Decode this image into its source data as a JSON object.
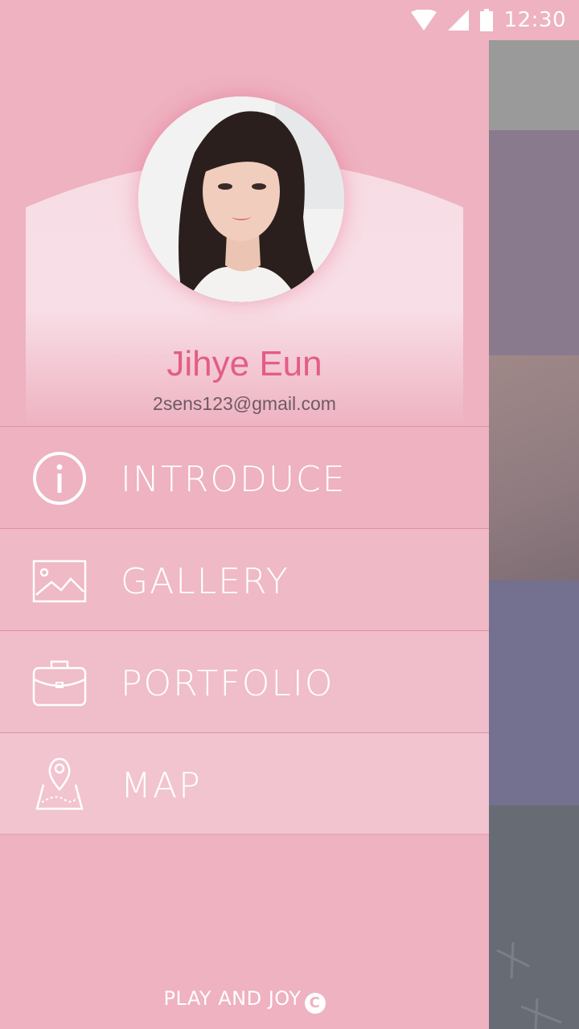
{
  "status_bar": {
    "time": "12:30",
    "icons": [
      "wifi-icon",
      "cellular-signal-icon",
      "battery-icon"
    ]
  },
  "profile": {
    "name": "Jihye Eun",
    "email": "2sens123@gmail.com"
  },
  "menu": {
    "items": [
      {
        "label": "INTRODUCE",
        "icon": "info-icon"
      },
      {
        "label": "GALLERY",
        "icon": "image-icon"
      },
      {
        "label": "PORTFOLIO",
        "icon": "briefcase-icon"
      },
      {
        "label": "MAP",
        "icon": "map-pin-icon"
      }
    ]
  },
  "footer": {
    "text": "PLAY AND JOY",
    "symbol": "C"
  },
  "colors": {
    "drawer_bg": "#eeb2c1",
    "name_accent": "#e35d86",
    "menu_text": "#ffffff"
  }
}
